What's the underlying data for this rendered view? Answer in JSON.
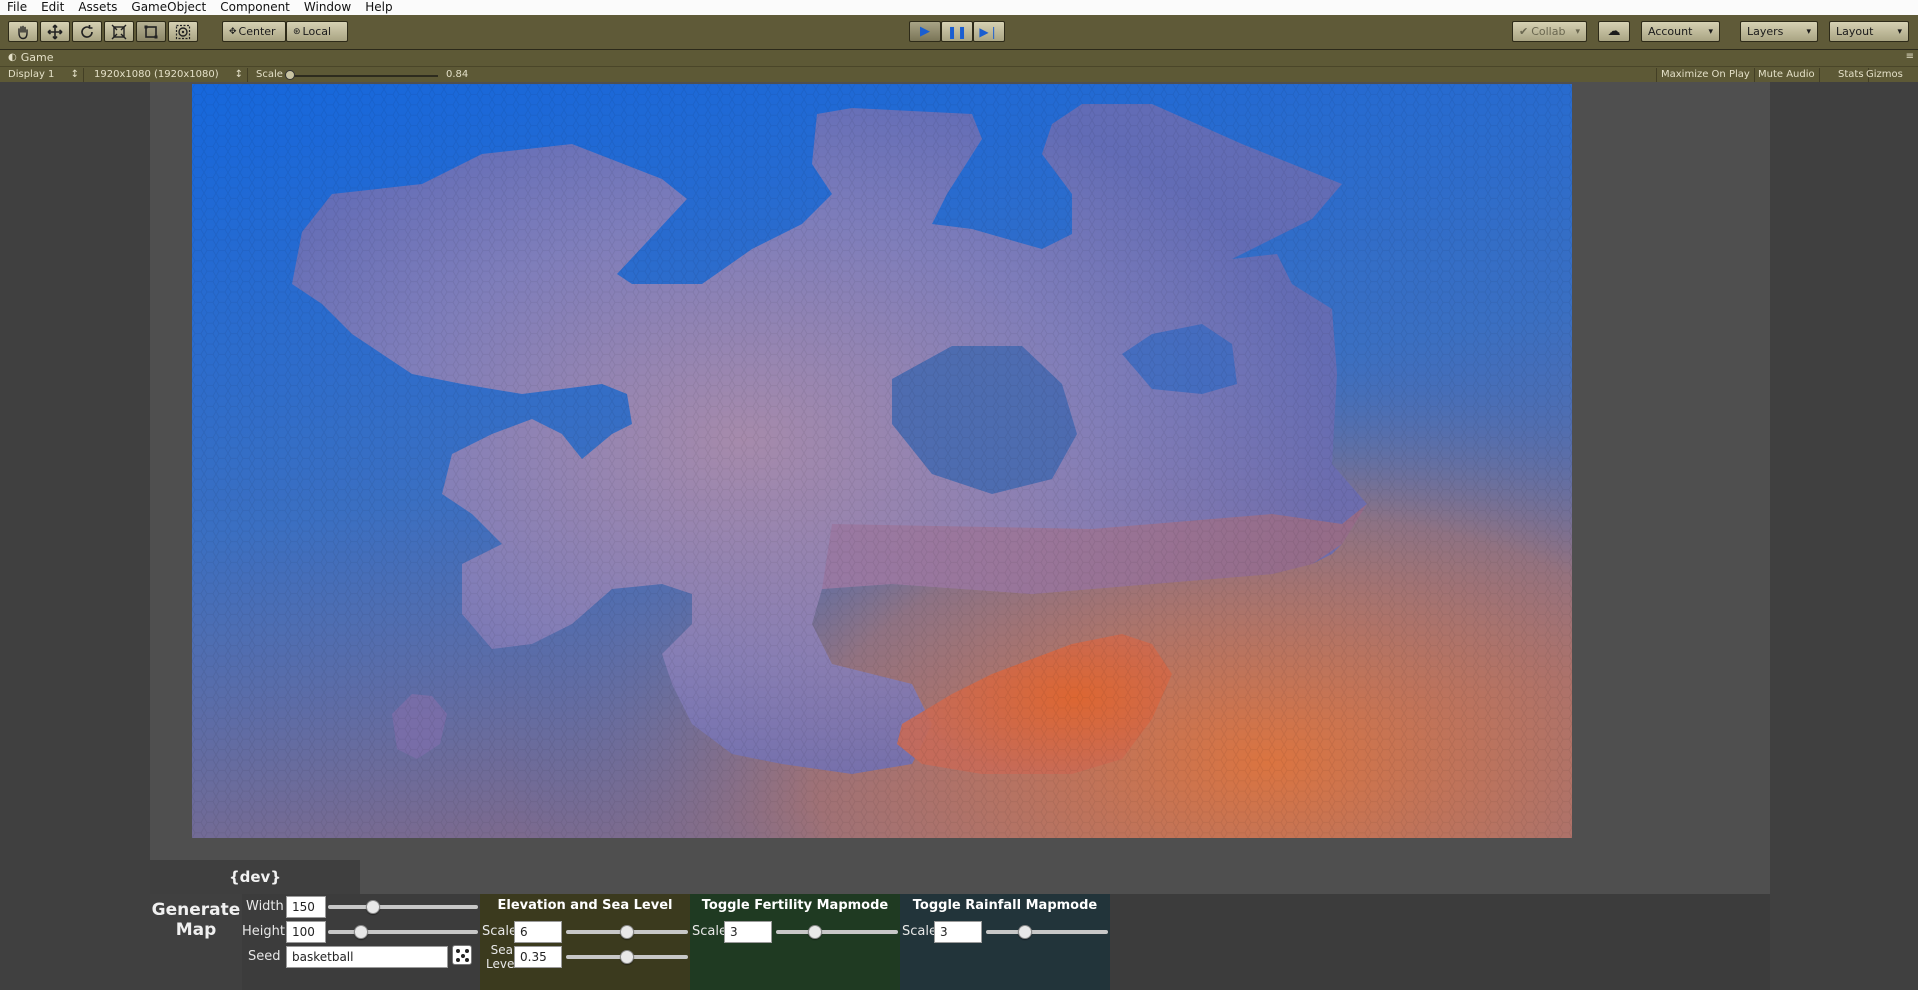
{
  "menu": [
    "File",
    "Edit",
    "Assets",
    "GameObject",
    "Component",
    "Window",
    "Help"
  ],
  "toolbar": {
    "pivot_label": "Center",
    "space_label": "Local",
    "collab_label": "Collab",
    "account_label": "Account",
    "layers_label": "Layers",
    "layout_label": "Layout",
    "play_icon": "play-icon",
    "pause_icon": "pause-icon",
    "step_icon": "step-icon"
  },
  "game": {
    "tab_title": "Game",
    "display": "Display 1",
    "resolution": "1920x1080 (1920x1080)",
    "scale_label": "Scale",
    "scale_value": "0.84",
    "scale_fraction": 0.0,
    "maximize": "Maximize On Play",
    "mute": "Mute Audio",
    "stats": "Stats",
    "gizmos": "Gizmos"
  },
  "panel": {
    "dev_label": "{dev}",
    "generate_line1": "Generate",
    "generate_line2": "Map",
    "width_label": "Width",
    "width_value": "150",
    "width_slider": 0.3,
    "height_label": "Height",
    "height_value": "100",
    "height_slider": 0.22,
    "seed_label": "Seed",
    "seed_value": "basketball",
    "elevation": {
      "title": "Elevation and Sea Level",
      "color": "#3b3a1e",
      "scale_label": "Scale",
      "scale_value": "6",
      "scale_slider": 0.5,
      "sea_label_1": "Sea",
      "sea_label_2": "Level",
      "sea_value": "0.35",
      "sea_slider": 0.5
    },
    "fertility": {
      "title": "Toggle Fertility Mapmode",
      "color": "#1f3a22",
      "scale_label": "Scale",
      "scale_value": "3",
      "scale_slider": 0.32
    },
    "rainfall": {
      "title": "Toggle Rainfall Mapmode",
      "color": "#22343a",
      "scale_label": "Scale",
      "scale_value": "3",
      "scale_slider": 0.32
    }
  },
  "colors": {
    "ocean_top": "#1a66d8",
    "ocean_bottom": "#e07a4e",
    "land": "#8a7eb8",
    "land_warm": "#d86a3c"
  }
}
